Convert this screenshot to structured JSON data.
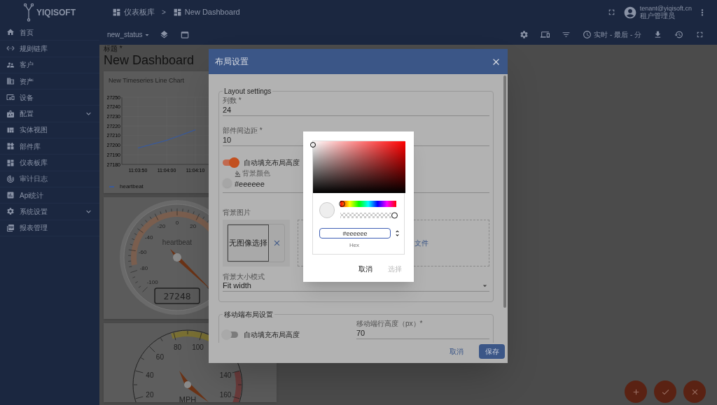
{
  "header": {
    "logo": "YIQISOFT",
    "breadcrumb": {
      "items": [
        "仪表板库",
        "New Dashboard"
      ],
      "separator": ">"
    },
    "user": {
      "email": "tenant@yiqisoft.cn",
      "role": "租户管理员"
    }
  },
  "sidebar": {
    "items": [
      {
        "label": "首页",
        "has_submenu": false
      },
      {
        "label": "规则链库",
        "has_submenu": false
      },
      {
        "label": "客户",
        "has_submenu": false
      },
      {
        "label": "资产",
        "has_submenu": false
      },
      {
        "label": "设备",
        "has_submenu": false
      },
      {
        "label": "配置",
        "has_submenu": true
      },
      {
        "label": "实体视图",
        "has_submenu": false
      },
      {
        "label": "部件库",
        "has_submenu": false
      },
      {
        "label": "仪表板库",
        "has_submenu": false
      },
      {
        "label": "审计日志",
        "has_submenu": false
      },
      {
        "label": "Api统计",
        "has_submenu": false
      },
      {
        "label": "系统设置",
        "has_submenu": true
      },
      {
        "label": "报表管理",
        "has_submenu": false
      }
    ]
  },
  "toolbar": {
    "state_selector": "new_status",
    "timewindow": "实时 - 最后 - 分"
  },
  "dashboard": {
    "title_label": "标题 *",
    "title": "New Dashboard",
    "line_chart": {
      "title": "New Timeseries Line Chart",
      "chart_data": {
        "type": "line",
        "categories": [
          "11:03:50",
          "11:04:00",
          "11:04:10"
        ],
        "series": [
          {
            "name": "heartbeat",
            "color": "#3a5a9a",
            "values": [
              27197,
              27205,
              27216
            ]
          }
        ],
        "ylim": [
          27180,
          27250
        ],
        "yticks": [
          27180,
          27190,
          27200,
          27210,
          27220,
          27230,
          27240,
          27250
        ]
      }
    },
    "gauge": {
      "label": "heartbeat",
      "value": "27248",
      "tick_labels": [
        "-100",
        "-80",
        "-60",
        "-40",
        "-20",
        "0",
        "20"
      ]
    },
    "speedometer": {
      "unit": "MPH",
      "tick_labels": [
        "20",
        "40",
        "60",
        "80",
        "100",
        "140",
        "160"
      ]
    }
  },
  "dialog": {
    "title": "布局设置",
    "layout_settings": {
      "legend": "Layout settings",
      "columns": {
        "label": "列数 *",
        "value": "24"
      },
      "margin": {
        "label": "部件间边距 *",
        "value": "10"
      },
      "auto_fill": {
        "label": "自动填充布局高度",
        "on": true
      },
      "background_color": {
        "label": "背景颜色",
        "value": "#eeeeee"
      },
      "background_image": {
        "label": "背景图片",
        "placeholder": "无图像选择",
        "drop_text": "文件"
      },
      "background_size": {
        "label": "背景大小模式",
        "value": "Fit width"
      }
    },
    "mobile_settings": {
      "legend": "移动端布局设置",
      "auto_fill": {
        "label": "自动填充布局高度",
        "on": false
      },
      "row_height": {
        "label": "移动端行高度（px）*",
        "value": "70"
      }
    },
    "buttons": {
      "cancel": "取消",
      "save": "保存"
    }
  },
  "color_picker": {
    "hue": {
      "level": 0
    },
    "alpha": {
      "level": 1
    },
    "hex": "#eeeeee",
    "hex_label": "Hex",
    "buttons": [
      {
        "label": "取消",
        "disabled": false
      },
      {
        "label": "选择",
        "disabled": true
      }
    ]
  }
}
